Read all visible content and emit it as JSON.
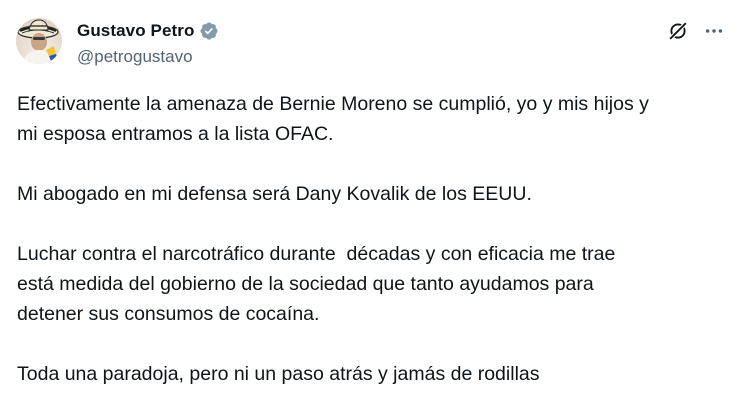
{
  "author": {
    "display_name": "Gustavo Petro",
    "handle": "@petrogustavo",
    "verified": true,
    "avatar_icon": "avatar-photo"
  },
  "actions": {
    "grok_icon": "grok-icon",
    "more_icon": "more-icon"
  },
  "tweet": {
    "paragraphs": [
      "Efectivamente la amenaza de Bernie Moreno se cumplió, yo y mis hijos y\nmi esposa entramos a la lista OFAC.",
      "Mi abogado en mi defensa será Dany Kovalik de los EEUU.",
      "Luchar contra el narcotráfico durante  décadas y con eficacia me trae\nestá medida del gobierno de la sociedad que tanto ayudamos para\ndetener sus consumos de cocaína.",
      "Toda una paradoja, pero ni un paso atrás y jamás de rodillas"
    ]
  },
  "colors": {
    "text": "#0f1419",
    "secondary_text": "#536471",
    "verified_badge": "#829aab",
    "background": "#ffffff"
  }
}
